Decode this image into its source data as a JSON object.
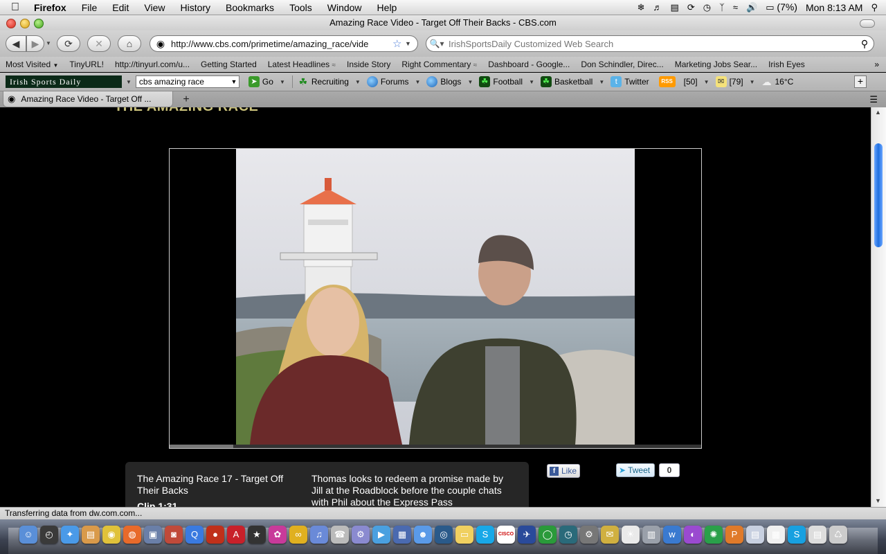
{
  "menubar": {
    "app": "Firefox",
    "items": [
      "File",
      "Edit",
      "View",
      "History",
      "Bookmarks",
      "Tools",
      "Window",
      "Help"
    ],
    "battery": "(7%)",
    "clock": "Mon 8:13 AM"
  },
  "window": {
    "title": "Amazing Race Video - Target Off Their Backs - CBS.com"
  },
  "navbar": {
    "url": "http://www.cbs.com/primetime/amazing_race/vide",
    "search_placeholder": "IrishSportsDaily Customized Web Search"
  },
  "bookmarks": [
    "Most Visited",
    "TinyURL!",
    "http://tinyurl.com/u...",
    "Getting Started",
    "Latest Headlines",
    "Inside Story",
    "Right Commentary",
    "Dashboard - Google...",
    "Don Schindler, Direc...",
    "Marketing Jobs Sear...",
    "Irish Eyes"
  ],
  "toolbar2": {
    "logo_text": "Irish Sports Daily",
    "search_value": "cbs amazing race",
    "go": "Go",
    "recruiting": "Recruiting",
    "forums": "Forums",
    "blogs": "Blogs",
    "football": "Football",
    "basketball": "Basketball",
    "twitter": "Twitter",
    "rss_label": "RSS",
    "rss_count": "[50]",
    "mail_count": "[79]",
    "temperature": "16°C"
  },
  "tab": {
    "label": "Amazing Race Video - Target Off ..."
  },
  "page": {
    "show_title": "THE AMAZING RACE",
    "clip_title": "The Amazing Race 17 - Target Off Their Backs",
    "clip_duration": "Clip 1:31",
    "clip_description": "Thomas looks to redeem a promise made by Jill at the Roadblock before the couple chats with Phil about the Express Pass",
    "like_label": "Like",
    "tweet_label": "Tweet",
    "tweet_count": "0",
    "progress": 0.12
  },
  "status": {
    "text": "Transferring data from dw.com.com..."
  },
  "dock": {
    "icons": [
      "finder-icon",
      "dashboard-icon",
      "safari-icon",
      "preview-icon",
      "chrome-icon",
      "firefox-icon",
      "iphoto-icon",
      "photobooth-icon",
      "quicktime-icon",
      "red-app-icon",
      "acrobat-icon",
      "star-app-icon",
      "flower-app-icon",
      "yellow-app-icon",
      "itunes-icon",
      "phone-app-icon",
      "utility-icon",
      "video-icon",
      "dashboard2-icon",
      "ichat-icon",
      "dvd-icon",
      "stickies-icon",
      "skype-icon",
      "cisco-icon",
      "preferences-icon",
      "green-app-icon",
      "timemachine-icon",
      "gear-app-icon",
      "mail-app-icon",
      "lamp-icon",
      "scanner-icon",
      "wave-app-icon",
      "purple-app-icon",
      "tree-app-icon",
      "p-app-icon",
      "files-icon",
      "calendar-icon",
      "skype2-icon",
      "downloads-icon",
      "trash-icon"
    ],
    "cisco_label": "CISCO"
  }
}
